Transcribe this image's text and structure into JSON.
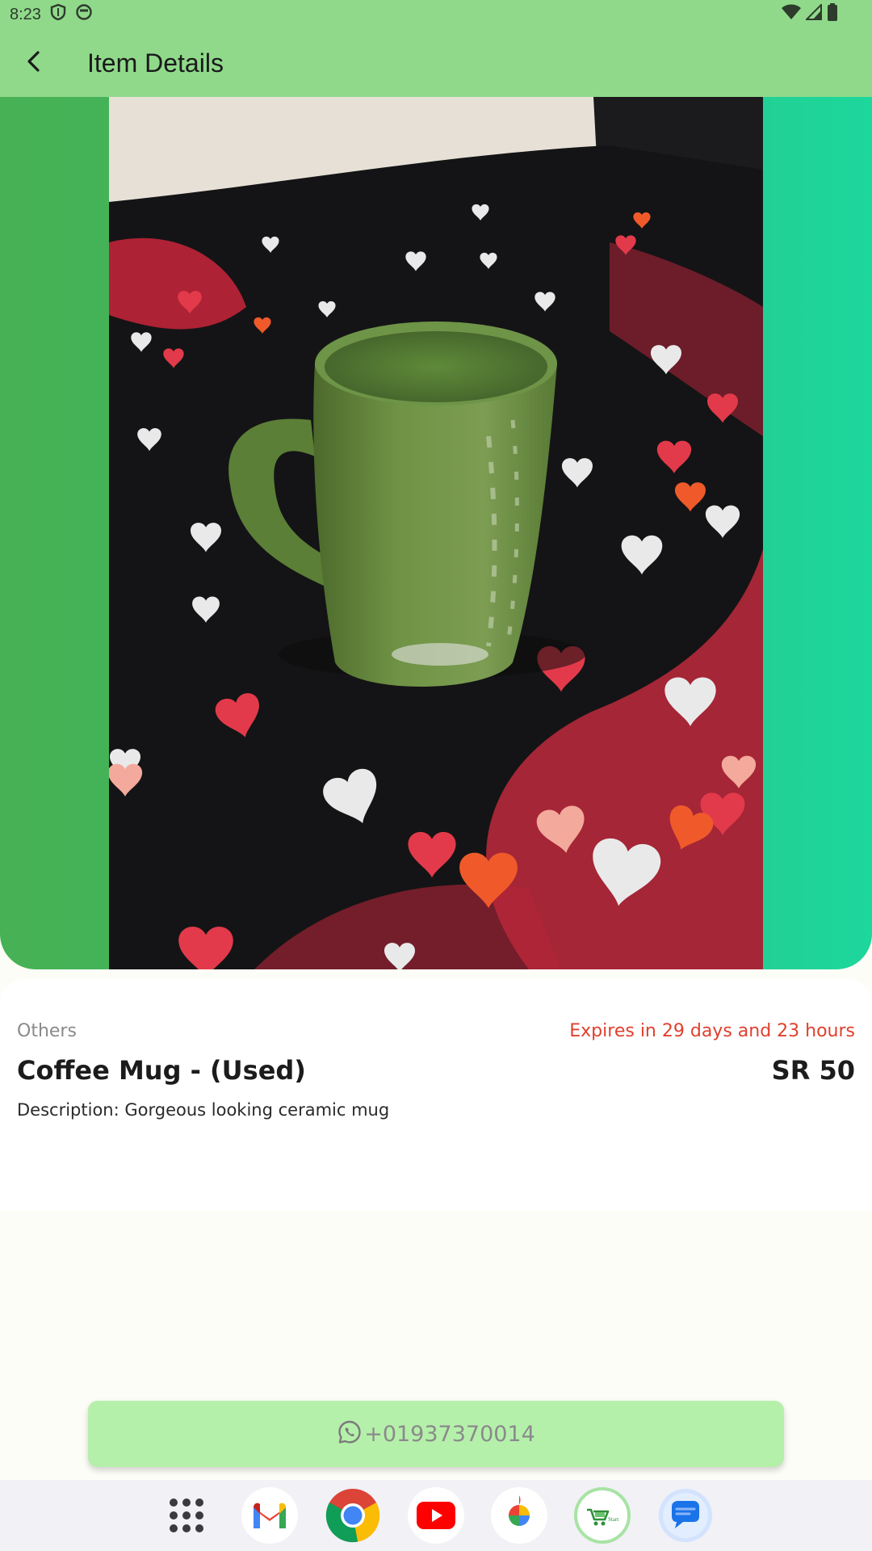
{
  "status_bar": {
    "time": "8:23"
  },
  "app_bar": {
    "title": "Item Details"
  },
  "item": {
    "category": "Others",
    "expiry": "Expires in 29 days and 23 hours",
    "title": "Coffee Mug - (Used)",
    "price": "SR 50",
    "description": "Description: Gorgeous looking ceramic mug"
  },
  "contact": {
    "phone": "+01937370014"
  },
  "dock": {
    "apps": [
      "app-drawer-icon",
      "gmail-icon",
      "chrome-icon",
      "youtube-icon",
      "photos-icon",
      "shop-app-icon",
      "messages-icon"
    ]
  },
  "colors": {
    "app_bar": "#90d98b",
    "contact_button": "#b5f0ab",
    "expiry_text": "#e0402e"
  }
}
